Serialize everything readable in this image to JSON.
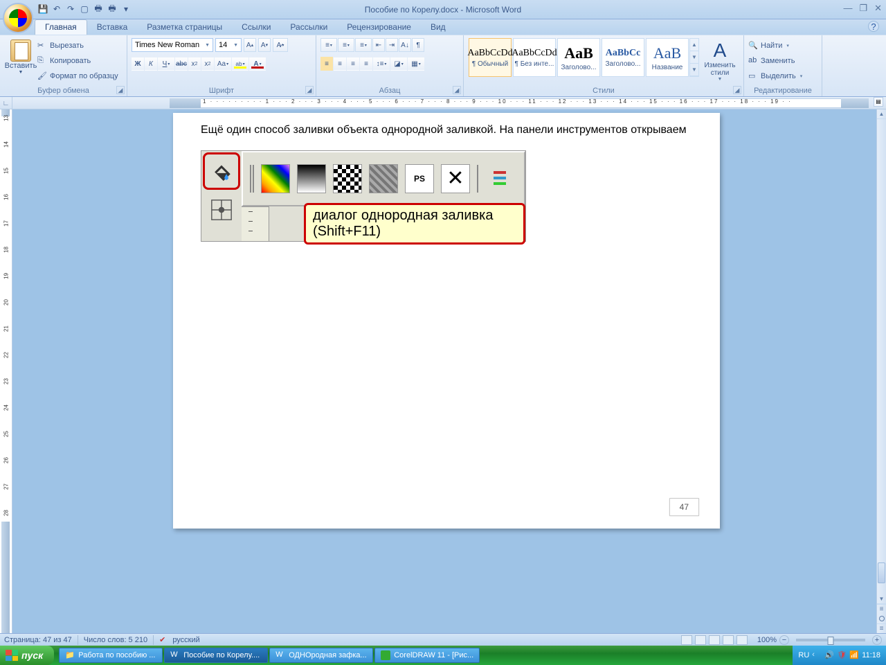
{
  "titlebar": {
    "title": "Пособие по Корелу.docx - Microsoft Word"
  },
  "tabs": [
    "Главная",
    "Вставка",
    "Разметка страницы",
    "Ссылки",
    "Рассылки",
    "Рецензирование",
    "Вид"
  ],
  "active_tab": 0,
  "clipboard": {
    "paste": "Вставить",
    "cut": "Вырезать",
    "copy": "Копировать",
    "format_painter": "Формат по образцу",
    "group": "Буфер обмена"
  },
  "font": {
    "name": "Times New Roman",
    "size": "14",
    "group": "Шрифт"
  },
  "paragraph": {
    "group": "Абзац"
  },
  "styles": {
    "items": [
      {
        "preview": "AaBbCcDd",
        "label": "¶ Обычный"
      },
      {
        "preview": "AaBbCcDd",
        "label": "¶ Без инте..."
      },
      {
        "preview": "AaB",
        "label": "Заголово..."
      },
      {
        "preview": "AaBbCc",
        "label": "Заголово..."
      },
      {
        "preview": "AaB",
        "label": "Название"
      }
    ],
    "change": "Изменить стили",
    "group": "Стили"
  },
  "editing": {
    "find": "Найти",
    "replace": "Заменить",
    "select": "Выделить",
    "group": "Редактирование"
  },
  "document": {
    "text": "Ещё один способ заливки объекта однородной заливкой. На панели инструментов открываем",
    "tooltip": "диалог однородная заливка (Shift+F11)",
    "page_number": "47"
  },
  "statusbar": {
    "page": "Страница: 47 из 47",
    "words": "Число слов: 5 210",
    "language": "русский",
    "zoom": "100%"
  },
  "taskbar": {
    "start": "пуск",
    "items": [
      {
        "label": "Работа по пособию ...",
        "type": "folder"
      },
      {
        "label": "Пособие по Корелу....",
        "type": "word",
        "active": true
      },
      {
        "label": "ОДНОродная зафка...",
        "type": "word"
      },
      {
        "label": "CorelDRAW 11 - [Рис...",
        "type": "corel"
      }
    ],
    "lang": "RU",
    "time": "11:18"
  },
  "ruler": "1 · · · · · · · · · 1 · · · 2 · · · 3 · · · 4 · · · 5 · · · 6 · · · 7 · · · 8 · · · 9 · · · 10 · · · 11 · · · 12 · · · 13 · · · 14 · · · 15 · · · 16 · · · 17 · · · 18 · · · 19 · ·"
}
